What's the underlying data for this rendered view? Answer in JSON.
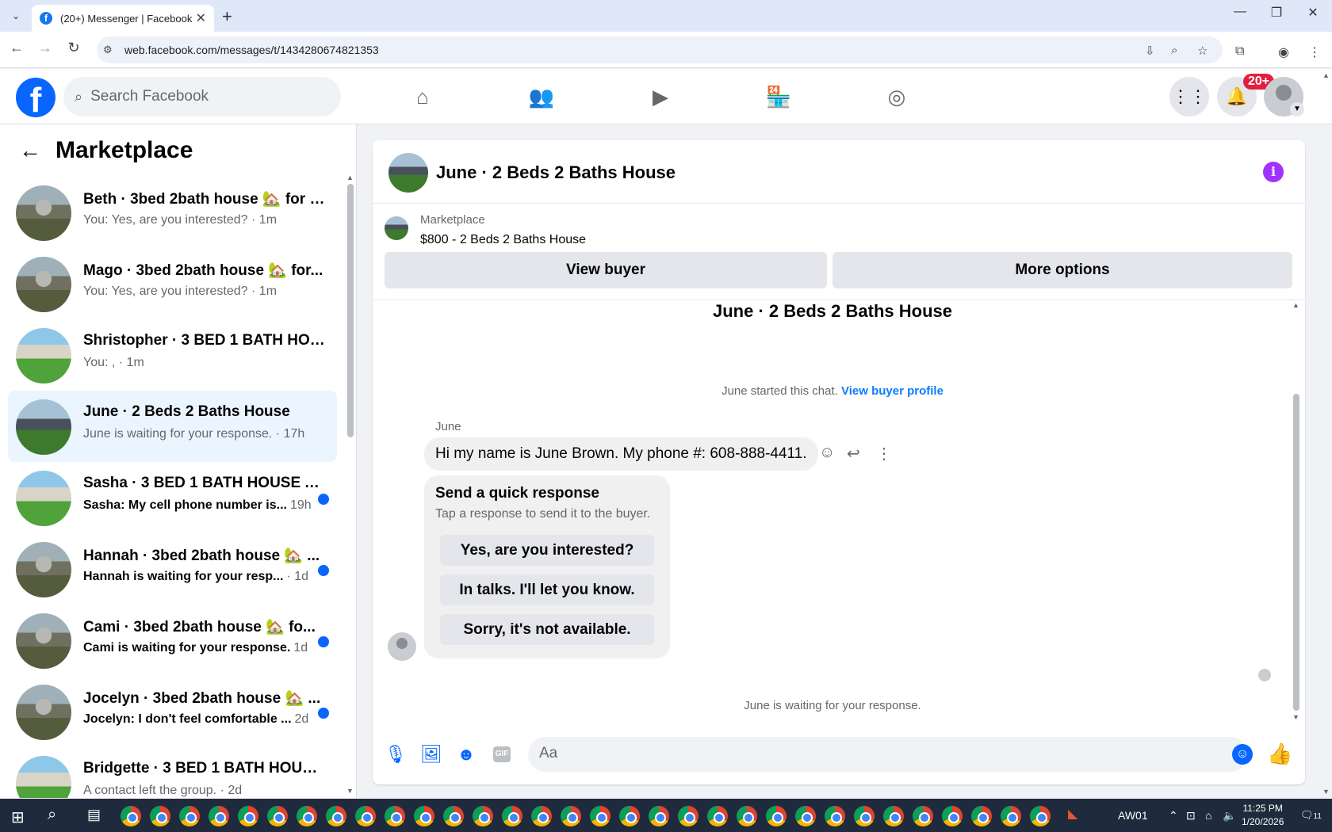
{
  "browser": {
    "tab_title": "(20+) Messenger | Facebook",
    "url": "web.facebook.com/messages/t/1434280674821353"
  },
  "header": {
    "search_placeholder": "Search Facebook",
    "notification_badge": "20+"
  },
  "sidebar": {
    "title": "Marketplace",
    "conversations": [
      {
        "title": "Beth · 3bed 2bath house 🏡 for r...",
        "subtitle": "You: Yes, are you interested? · 1m",
        "unread": false,
        "thumb": "a"
      },
      {
        "title": "Mago · 3bed 2bath house 🏡 for...",
        "subtitle": "You: Yes, are you interested? · 1m",
        "unread": false,
        "thumb": "a"
      },
      {
        "title": "Shristopher · 3 BED 1 BATH HOU...",
        "subtitle": "You: , · 1m",
        "unread": false,
        "thumb": "b"
      },
      {
        "title": "June · 2 Beds 2 Baths House",
        "subtitle": "June is waiting for your response. · 17h",
        "unread": false,
        "thumb": "c",
        "active": true
      },
      {
        "title": "Sasha · 3 BED 1 BATH HOUSE A...",
        "subtitle": "Sasha: My cell phone number is...",
        "meta": "19h",
        "unread": true,
        "thumb": "b"
      },
      {
        "title": "Hannah · 3bed 2bath house 🏡 ...",
        "subtitle": "Hannah is waiting for your resp...",
        "meta": "· 1d",
        "unread": true,
        "thumb": "a"
      },
      {
        "title": "Cami · 3bed 2bath house 🏡 fo...",
        "subtitle": "Cami is waiting for your response.",
        "meta": "1d",
        "unread": true,
        "thumb": "a"
      },
      {
        "title": "Jocelyn · 3bed 2bath house 🏡 ...",
        "subtitle": "Jocelyn: I don't feel comfortable ...",
        "meta": "2d",
        "unread": true,
        "thumb": "a"
      },
      {
        "title": "Bridgette · 3 BED 1 BATH HOUSE...",
        "subtitle": "A contact left the group. · 2d",
        "unread": false,
        "thumb": "b"
      }
    ]
  },
  "chat": {
    "header_title": "June · 2 Beds 2 Baths House",
    "listing_source": "Marketplace",
    "listing_price": "$800 - 2 Beds 2 Baths House",
    "view_buyer_label": "View buyer",
    "more_options_label": "More options",
    "conversation_title": "June · 2 Beds 2 Baths House",
    "started_text": "June started this chat.",
    "view_buyer_profile_label": "View buyer profile",
    "sender_name": "June",
    "message": "Hi my name is June Brown. My phone #: 608-888-4411.",
    "quick_response": {
      "title": "Send a quick response",
      "subtitle": "Tap a response to send it to the buyer.",
      "options": [
        "Yes, are you interested?",
        "In talks. I'll let you know.",
        "Sorry, it's not available."
      ]
    },
    "waiting_text": "June is waiting for your response.",
    "composer_placeholder": "Aa"
  },
  "taskbar": {
    "user_label": "AW01",
    "time": "11:25 PM",
    "date": "1/20/2026",
    "notif_count": "11"
  },
  "colors": {
    "brand": "#0866ff",
    "active_row": "#ebf5ff",
    "info_icon": "#a033ff",
    "badge": "#e41e3f"
  }
}
